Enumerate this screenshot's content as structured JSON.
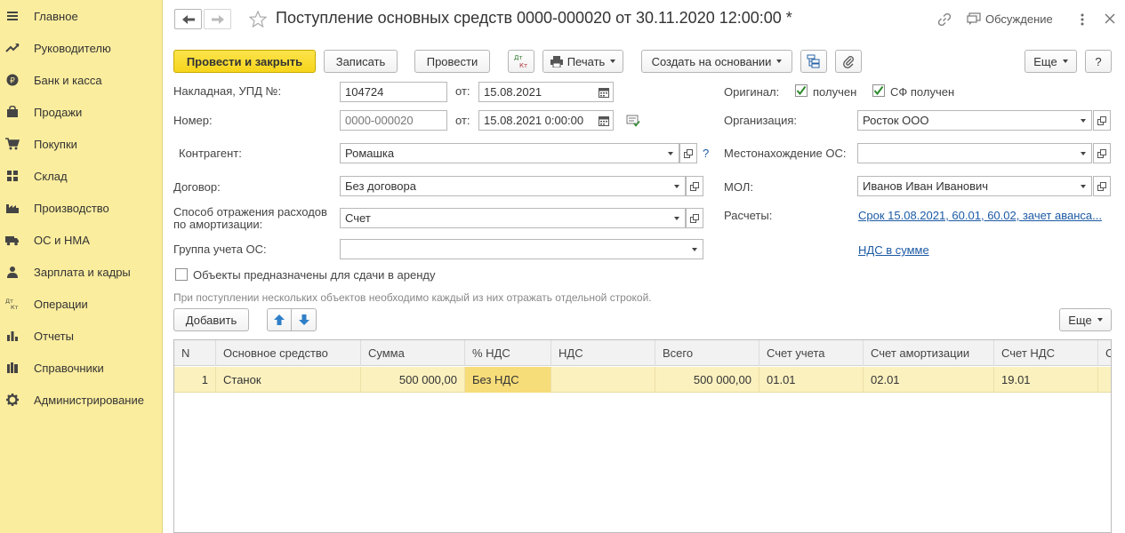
{
  "sidebar": {
    "items": [
      {
        "label": "Главное",
        "icon": "menu-icon"
      },
      {
        "label": "Руководителю",
        "icon": "trend-icon"
      },
      {
        "label": "Банк и касса",
        "icon": "ruble-icon"
      },
      {
        "label": "Продажи",
        "icon": "bag-icon"
      },
      {
        "label": "Покупки",
        "icon": "cart-icon"
      },
      {
        "label": "Склад",
        "icon": "warehouse-icon"
      },
      {
        "label": "Производство",
        "icon": "factory-icon"
      },
      {
        "label": "ОС и НМА",
        "icon": "truck-icon"
      },
      {
        "label": "Зарплата и кадры",
        "icon": "person-icon"
      },
      {
        "label": "Операции",
        "icon": "dt-kt-icon"
      },
      {
        "label": "Отчеты",
        "icon": "bar-chart-icon"
      },
      {
        "label": "Справочники",
        "icon": "books-icon"
      },
      {
        "label": "Администрирование",
        "icon": "gear-icon"
      }
    ]
  },
  "header": {
    "title": "Поступление основных средств 0000-000020 от 30.11.2020 12:00:00 *",
    "discussion": "Обсуждение"
  },
  "toolbar": {
    "post_close": "Провести и закрыть",
    "save": "Записать",
    "post": "Провести",
    "dtkt": "Дт Кт",
    "print": "Печать",
    "create_based": "Создать на основании",
    "more": "Еще",
    "help": "?"
  },
  "form": {
    "invoice_label": "Накладная, УПД №:",
    "invoice_number": "104724",
    "from_label": "от:",
    "invoice_date": "15.08.2021",
    "number_label": "Номер:",
    "number_value": "0000-000020",
    "number_date": "15.08.2021  0:00:00",
    "counterparty_label": "Контрагент:",
    "counterparty_value": "Ромашка",
    "question": "?",
    "contract_label": "Договор:",
    "contract_value": "Без договора",
    "method_label_1": "Способ отражения расходов",
    "method_label_2": "по амортизации:",
    "method_value": "Счет",
    "group_label": "Группа учета ОС:",
    "group_value": "",
    "rent_checkbox": "Объекты предназначены для сдачи в аренду",
    "original_label": "Оригинал:",
    "received": "получен",
    "sf_received": "СФ получен",
    "org_label": "Организация:",
    "org_value": "Росток ООО",
    "location_label": "Местонахождение ОС:",
    "location_value": "",
    "mol_label": "МОЛ:",
    "mol_value": "Иванов Иван Иванович",
    "payments_label": "Расчеты:",
    "payments_link": "Срок 15.08.2021, 60.01, 60.02, зачет аванса...",
    "vat_link": "НДС в сумме"
  },
  "hint": "При поступлении нескольких объектов необходимо каждый из них отражать отдельной строкой.",
  "table_toolbar": {
    "add": "Добавить",
    "more": "Еще"
  },
  "table": {
    "columns": [
      "N",
      "Основное средство",
      "Сумма",
      "% НДС",
      "НДС",
      "Всего",
      "Счет учета",
      "Счет амортизации",
      "Счет НДС",
      "С"
    ],
    "rows": [
      [
        "1",
        "Станок",
        "500 000,00",
        "Без НДС",
        "",
        "500 000,00",
        "01.01",
        "02.01",
        "19.01",
        ""
      ]
    ]
  },
  "colors": {
    "sidebar_bg": "#fbed9e",
    "primary_button": "#f7d51c",
    "selected_row": "#fbf1bf",
    "link": "#1c5aa4",
    "checkmark": "#2e8b2e"
  }
}
